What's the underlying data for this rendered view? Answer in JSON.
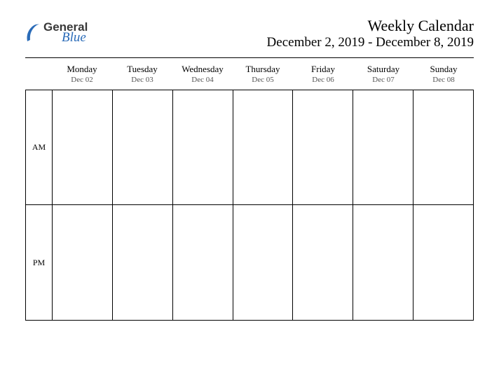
{
  "brand": {
    "word1": "General",
    "word2": "Blue"
  },
  "header": {
    "title": "Weekly Calendar",
    "range": "December 2, 2019 - December 8, 2019"
  },
  "days": [
    {
      "name": "Monday",
      "date": "Dec 02"
    },
    {
      "name": "Tuesday",
      "date": "Dec 03"
    },
    {
      "name": "Wednesday",
      "date": "Dec 04"
    },
    {
      "name": "Thursday",
      "date": "Dec 05"
    },
    {
      "name": "Friday",
      "date": "Dec 06"
    },
    {
      "name": "Saturday",
      "date": "Dec 07"
    },
    {
      "name": "Sunday",
      "date": "Dec 08"
    }
  ],
  "periods": [
    "AM",
    "PM"
  ]
}
